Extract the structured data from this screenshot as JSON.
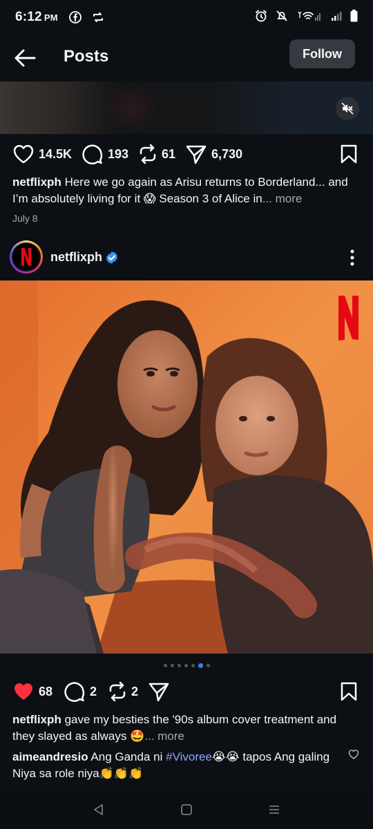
{
  "status_bar": {
    "time": "6:12",
    "ampm": "PM",
    "icons": [
      "facebook-icon",
      "repost-icon",
      "alarm-icon",
      "mute-bell-icon",
      "wifi-icon",
      "signal-icon",
      "battery-icon"
    ]
  },
  "header": {
    "title": "Posts",
    "follow_label": "Follow"
  },
  "prev_post": {
    "likes": "14.5K",
    "comments": "193",
    "reposts": "61",
    "shares": "6,730",
    "caption_user": "netflixph",
    "caption_text": "Here we go again as Arisu returns to Borderland... and I’m absolutely living for it 😱 Season 3 of Alice in",
    "caption_more": "... more",
    "date": "July 8"
  },
  "post": {
    "username": "netflixph",
    "brand_color": "#e50914",
    "brand_letter": "N",
    "carousel_count": 7,
    "carousel_active": 5,
    "likes": "68",
    "comments": "2",
    "reposts": "2",
    "caption_user": "netflixph",
    "caption_text": "gave my besties the '90s album cover treatment and they slayed as always 🤩",
    "caption_more": "... more",
    "comment_user": "aimeandresio",
    "comment_pre": "Ang Ganda ni",
    "comment_hashtag": "#Vivoree",
    "comment_post": "😭😭 tapos Ang galing Niya sa role niya👏👏👏"
  },
  "nav": {
    "icons": [
      "back-triangle-icon",
      "home-square-icon",
      "recents-menu-icon"
    ]
  }
}
